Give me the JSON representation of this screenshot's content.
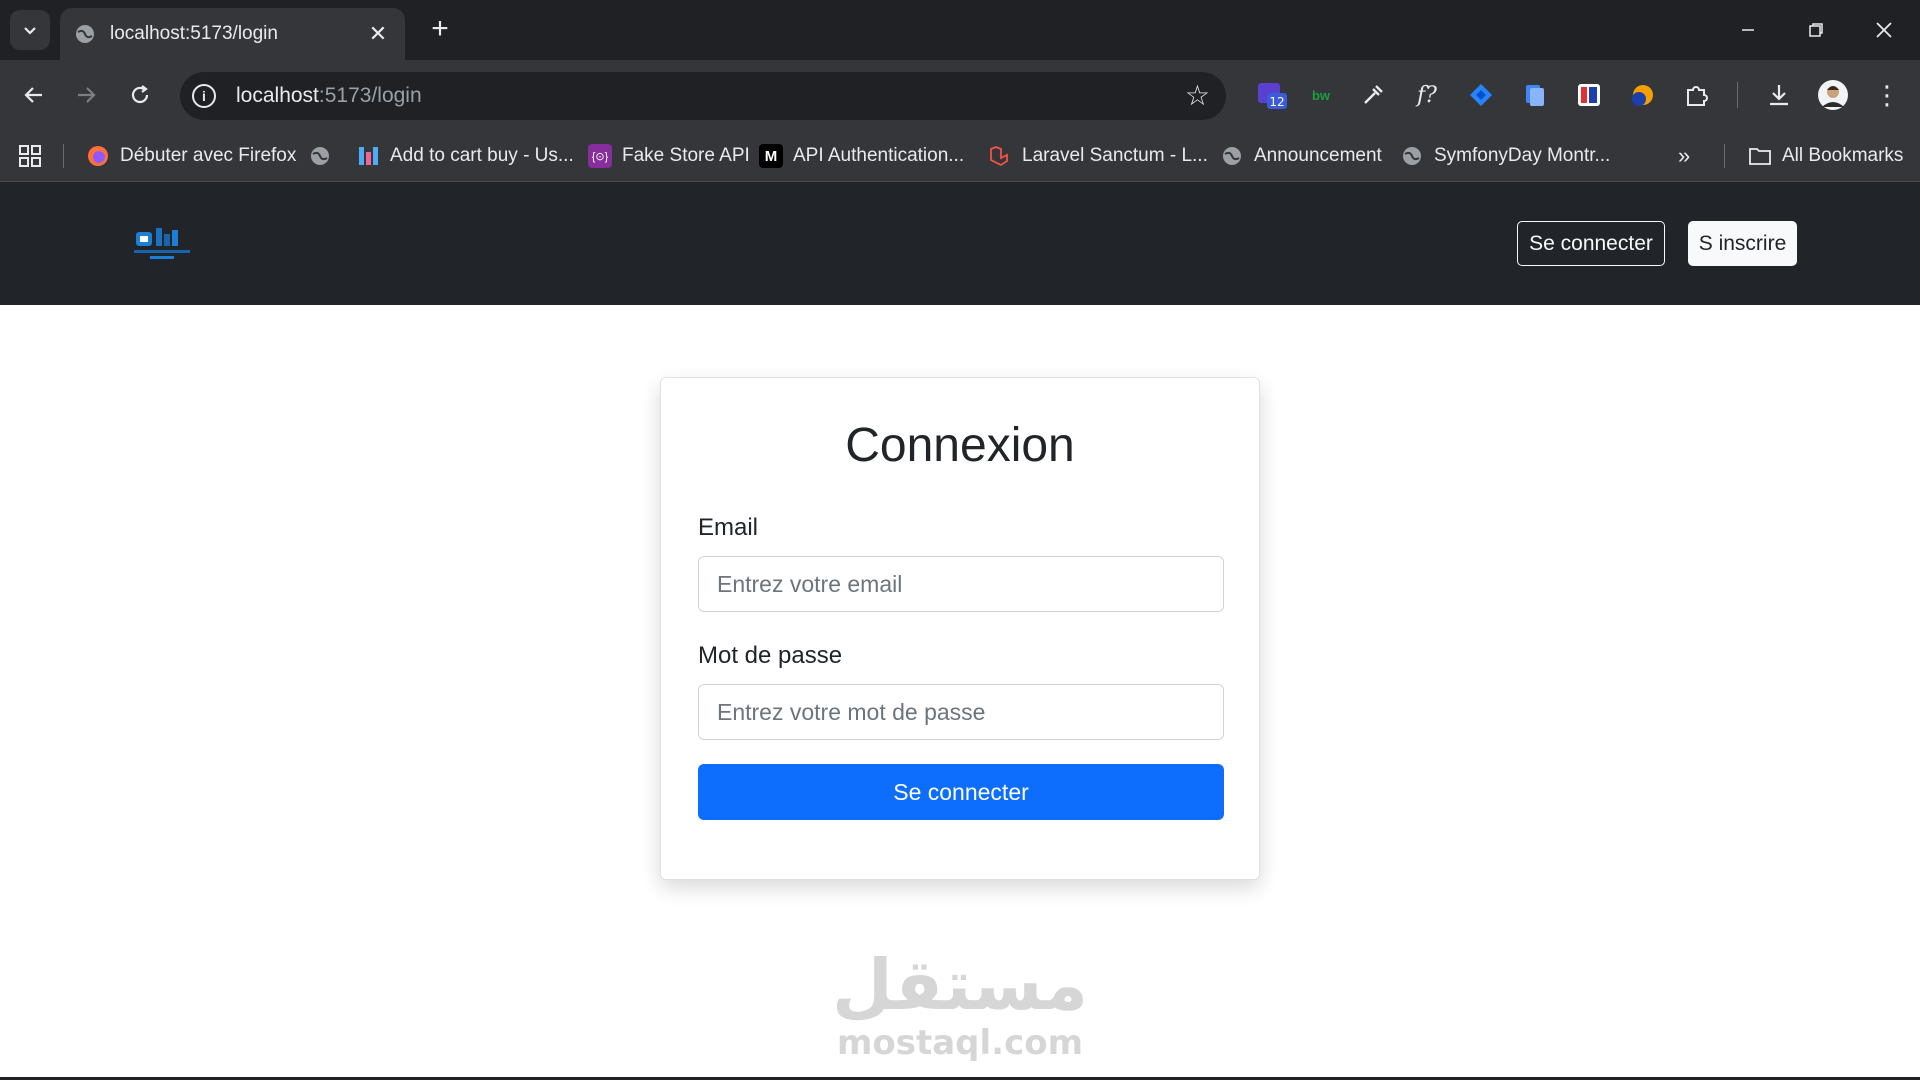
{
  "browser": {
    "tab_title": "localhost:5173/login",
    "url_host": "localhost",
    "url_path": ":5173/login",
    "extension_badge": "12",
    "bookmarks": [
      {
        "label": "Débuter avec Firefox",
        "icon": "firefox-icon"
      },
      {
        "label": "",
        "icon": "globe-icon"
      },
      {
        "label": "Add to cart buy - Us...",
        "icon": "app-icon"
      },
      {
        "label": "Fake Store API",
        "icon": "fakestore-icon"
      },
      {
        "label": "API Authentication...",
        "icon": "medium-icon"
      },
      {
        "label": "Laravel Sanctum - L...",
        "icon": "laravel-icon"
      },
      {
        "label": "Announcement",
        "icon": "globe-icon"
      },
      {
        "label": "SymfonyDay Montr...",
        "icon": "globe-icon"
      }
    ],
    "all_bookmarks": "All Bookmarks"
  },
  "navbar": {
    "login_button": "Se connecter",
    "signup_button": "S inscrire"
  },
  "login": {
    "title": "Connexion",
    "email_label": "Email",
    "email_placeholder": "Entrez votre email",
    "password_label": "Mot de passe",
    "password_placeholder": "Entrez votre mot de passe",
    "submit_label": "Se connecter"
  },
  "watermark": {
    "arabic": "مستقل",
    "latin": "mostaql.com"
  },
  "colors": {
    "primary": "#0d6efd",
    "navbar_bg": "#212529"
  }
}
